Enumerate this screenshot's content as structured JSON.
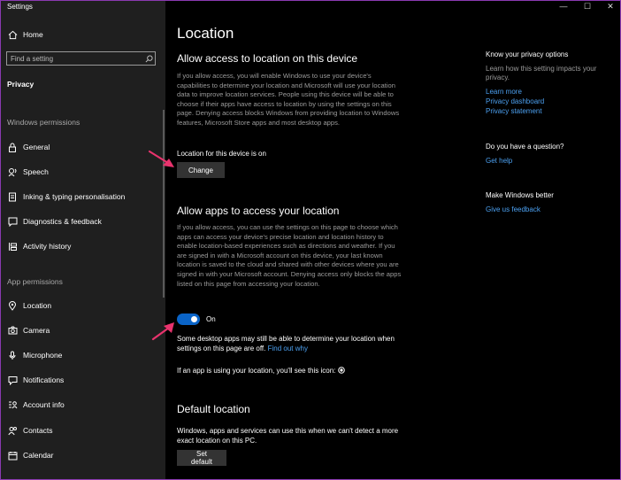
{
  "app": {
    "title": "Settings"
  },
  "window_controls": {
    "minimize": "—",
    "maximize": "☐",
    "close": "✕"
  },
  "sidebar": {
    "home": "Home",
    "search_placeholder": "Find a setting",
    "current": "Privacy",
    "windows_permissions_label": "Windows permissions",
    "windows_items": [
      {
        "label": "General",
        "icon": "lock-icon"
      },
      {
        "label": "Speech",
        "icon": "speech-icon"
      },
      {
        "label": "Inking & typing personalisation",
        "icon": "inking-icon"
      },
      {
        "label": "Diagnostics & feedback",
        "icon": "diagnostics-icon"
      },
      {
        "label": "Activity history",
        "icon": "activity-icon"
      }
    ],
    "app_permissions_label": "App permissions",
    "app_items": [
      {
        "label": "Location",
        "icon": "location-icon"
      },
      {
        "label": "Camera",
        "icon": "camera-icon"
      },
      {
        "label": "Microphone",
        "icon": "microphone-icon"
      },
      {
        "label": "Notifications",
        "icon": "notifications-icon"
      },
      {
        "label": "Account info",
        "icon": "account-info-icon"
      },
      {
        "label": "Contacts",
        "icon": "contacts-icon"
      },
      {
        "label": "Calendar",
        "icon": "calendar-icon"
      }
    ]
  },
  "main": {
    "title": "Location",
    "device_heading": "Allow access to location on this device",
    "device_para": "If you allow access, you will enable Windows to use your device's capabilities to determine your location and Microsoft will use your location data to improve location services. People using this device will be able to choose if their apps have access to location by using the settings on this page. Denying access blocks Windows from providing location to Windows features, Microsoft Store apps and most desktop apps.",
    "device_status": "Location for this device is on",
    "change_button": "Change",
    "apps_heading": "Allow apps to access your location",
    "apps_para": "If you allow access, you can use the settings on this page to choose which apps can access your device's precise location and location history to enable location-based experiences such as directions and weather. If you are signed in with a Microsoft account on this device, your last known location is saved to the cloud and shared with other devices where you are signed in with your Microsoft account. Denying access only blocks the apps listed on this page from accessing your location.",
    "toggle_state": "On",
    "desktop_note": "Some desktop apps may still be able to determine your location when settings on this page are off.",
    "find_out_why": "Find out why",
    "icon_note": "If an app is using your location, you'll see this icon:",
    "default_heading": "Default location",
    "default_para": "Windows, apps and services can use this when we can't detect a more exact location on this PC.",
    "set_default_button": "Set default"
  },
  "right": {
    "privacy_heading": "Know your privacy options",
    "privacy_sub": "Learn how this setting impacts your privacy.",
    "learn_more": "Learn more",
    "privacy_dashboard": "Privacy dashboard",
    "privacy_statement": "Privacy statement",
    "question_heading": "Do you have a question?",
    "get_help": "Get help",
    "better_heading": "Make Windows better",
    "feedback": "Give us feedback"
  },
  "colors": {
    "accent": "#0a64c8",
    "link": "#4ca0f0",
    "arrow": "#e8336d",
    "sidebar_bg": "#1f1f1f"
  }
}
